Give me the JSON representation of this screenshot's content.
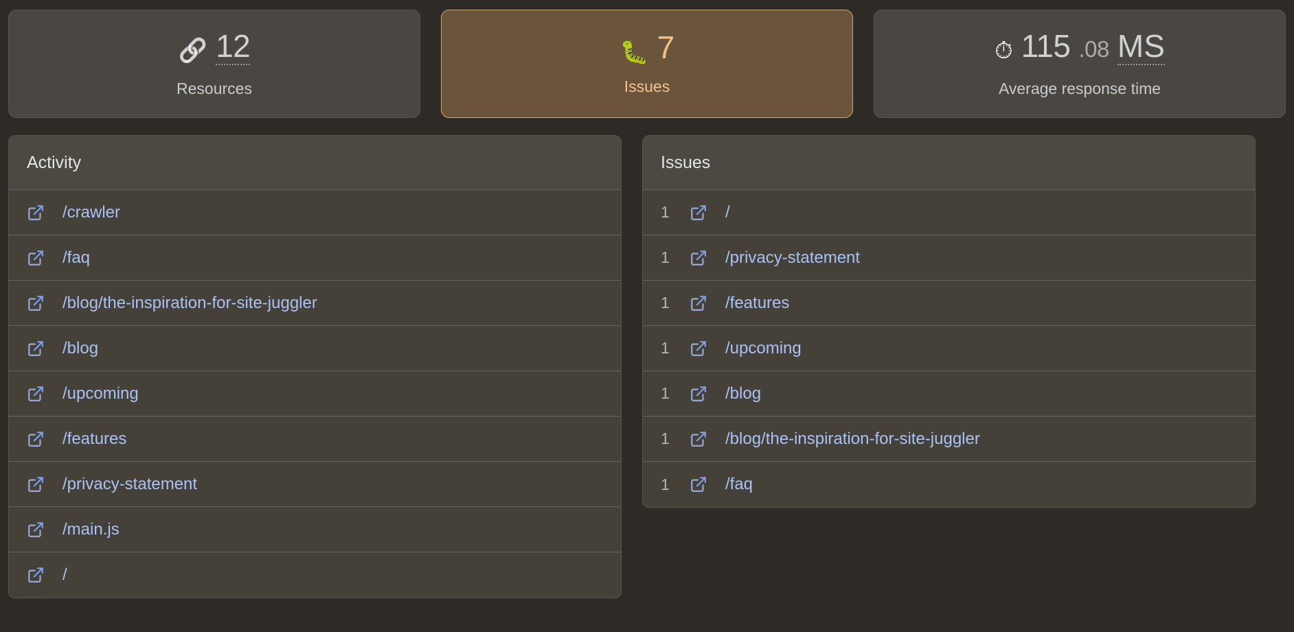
{
  "stats": [
    {
      "icon": "link-icon",
      "glyph": "🔗",
      "value": "12",
      "frac": "",
      "unit": "",
      "label": "Resources",
      "active": false,
      "underline_target": "value"
    },
    {
      "icon": "bug-icon",
      "glyph": "🐛",
      "value": "7",
      "frac": "",
      "unit": "",
      "label": "Issues",
      "active": true,
      "underline_target": "none"
    },
    {
      "icon": "stopwatch-icon",
      "glyph": "⏱",
      "value": "115",
      "frac": ".08",
      "unit": "MS",
      "label": "Average response time",
      "active": false,
      "underline_target": "unit"
    }
  ],
  "activity_panel": {
    "title": "Activity",
    "rows": [
      {
        "path": "/crawler"
      },
      {
        "path": "/faq"
      },
      {
        "path": "/blog/the-inspiration-for-site-juggler"
      },
      {
        "path": "/blog"
      },
      {
        "path": "/upcoming"
      },
      {
        "path": "/features"
      },
      {
        "path": "/privacy-statement"
      },
      {
        "path": "/main.js"
      },
      {
        "path": "/"
      }
    ]
  },
  "issues_panel": {
    "title": "Issues",
    "rows": [
      {
        "count": "1",
        "path": "/"
      },
      {
        "count": "1",
        "path": "/privacy-statement"
      },
      {
        "count": "1",
        "path": "/features"
      },
      {
        "count": "1",
        "path": "/upcoming"
      },
      {
        "count": "1",
        "path": "/blog"
      },
      {
        "count": "1",
        "path": "/blog/the-inspiration-for-site-juggler"
      },
      {
        "count": "1",
        "path": "/faq"
      }
    ]
  },
  "colors": {
    "page_background": "#2e2b27",
    "card_background": "#4a4641",
    "card_border": "#5a554e",
    "active_card_background": "#6b543c",
    "active_card_border": "#cda77c",
    "active_text": "#f2bd86",
    "link_text": "#a9c2f5",
    "row_background": "#454139",
    "row_divider": "#6a655d",
    "muted_text": "#b8b5b0"
  }
}
